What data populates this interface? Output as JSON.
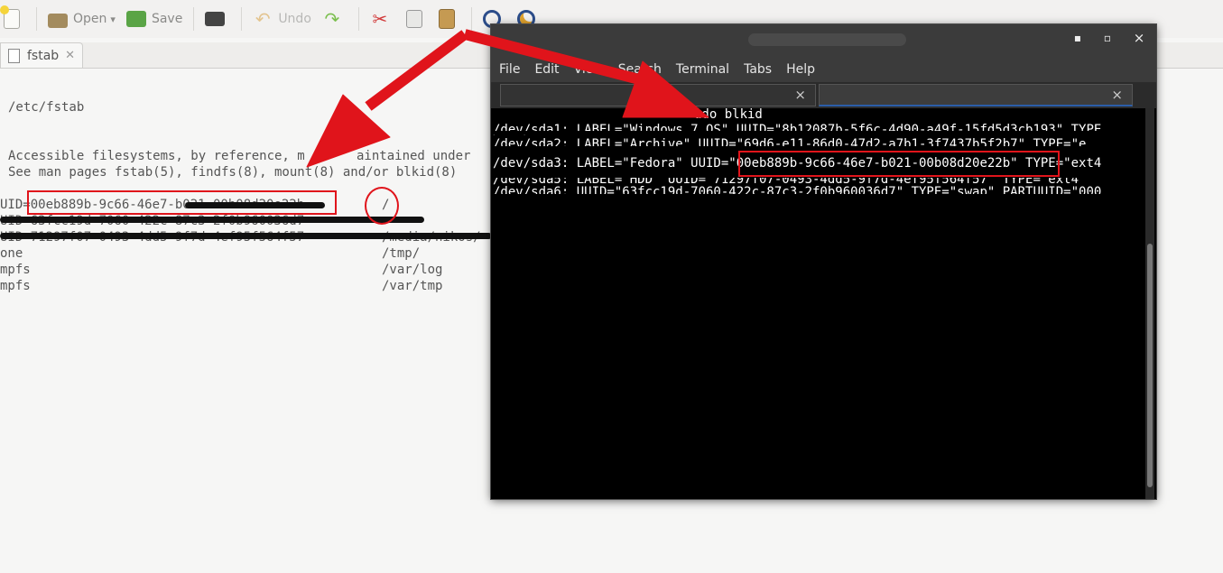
{
  "toolbar": {
    "open_label": "Open",
    "save_label": "Save",
    "undo_label": "Undo"
  },
  "tabs": [
    {
      "label": "fstab",
      "close": "✕"
    }
  ],
  "editor": {
    "line_path": "/etc/fstab",
    "line_accessible": "Accessible filesystems, by reference, m",
    "line_accessible_tail": "aintained under",
    "line_see": "See man pages fstab(5), findfs(8), mount(8) and/or blkid(8)",
    "row1_uuid": "UID=00eb889b-9c66-46e7-b021-00b08d20e22b",
    "row1_mount": "/",
    "row2_uuid": "UID=63fcc19d-7060-422c-87c3-2f0b960036d7",
    "row3_uuid": "UID=71297f07-0493-4dd5-9f7d-4ef95f564f57",
    "row3_mount": "/media/nikos/",
    "row4_src": "one",
    "row4_mount": "/tmp/",
    "row5_src": "mpfs",
    "row5_mount": "/var/log",
    "row6_src": "mpfs",
    "row6_mount": "/var/tmp"
  },
  "terminal": {
    "close": "×",
    "minimize": "▪",
    "maximize": "▫",
    "menu": [
      "File",
      "Edit",
      "View",
      "Search",
      "Terminal",
      "Tabs",
      "Help"
    ],
    "tab_close": "×",
    "lines": {
      "cmd": "udo blkid",
      "sda1": "/dev/sda1: LABEL=\"Windows 7 OS\" UUID=\"8b12087b-5f6c-4d90-a49f-15fd5d3cb193\" TYPE",
      "sda2": "/dev/sda2: LABEL=\"Archive\" UUID=\"69d6-e11-86d0-47d2-a7b1-3f7437b5f2b7\" TYPE=\"e",
      "sda3": "/dev/sda3: LABEL=\"Fedora\" UUID=\"00eb889b-9c66-46e7-b021-00b08d20e22b\" TYPE=\"ext4",
      "sda5": "/dev/sda5: LABEL=\"HDD\" UUID=\"71297f07-0493-4dd5-9f7d-4ef95f564f57\" TYPE=\"ext4\"",
      "sda6": "/dev/sda6: UUID=\"63fcc19d-7060-422c-87c3-2f0b960036d7\" TYPE=\"swap\" PARTUUID=\"000"
    }
  },
  "colors": {
    "annotation": "#e0141b",
    "terminal_bg": "#000000",
    "editor_bg": "#f6f6f5"
  }
}
